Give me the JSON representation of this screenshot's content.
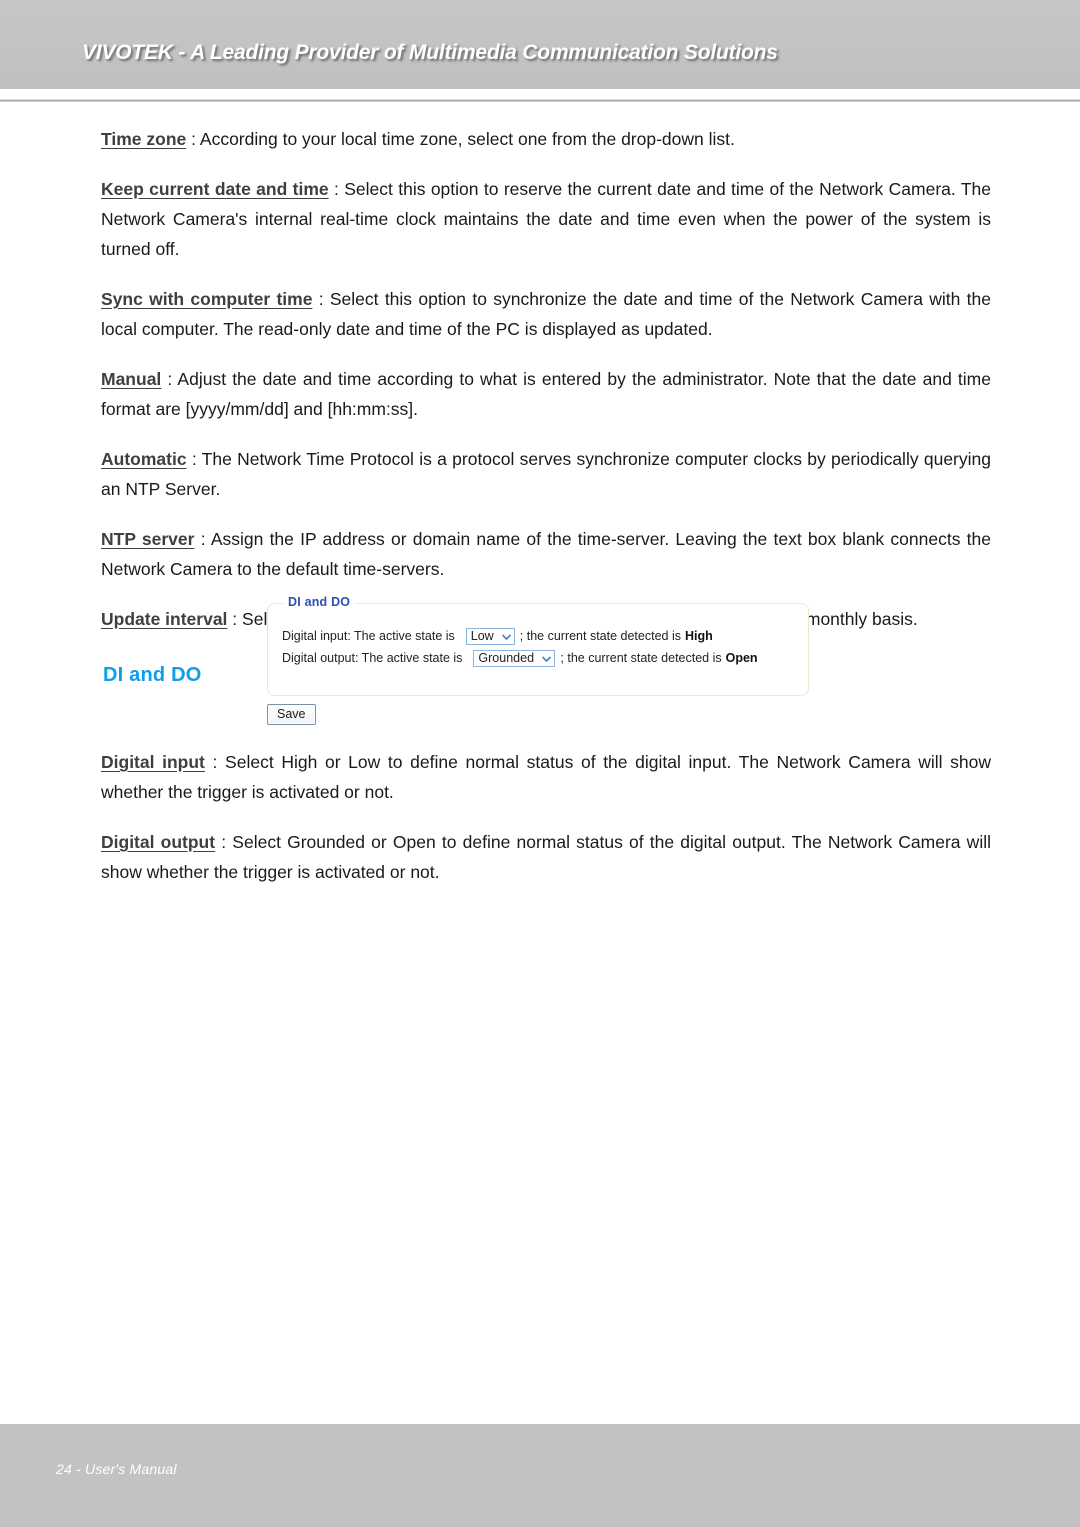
{
  "header": {
    "title": "VIVOTEK - A Leading Provider of Multimedia Communication Solutions"
  },
  "colors": {
    "header_band": "#c3c3c3",
    "heading_blue": "#0d9ee8",
    "legend_blue": "#2b4eb8",
    "panel_border": "#ece7d2",
    "select_border": "#8fb4df",
    "select_caret": "#3c7fd4",
    "footer_band": "#c2c2c2"
  },
  "paragraphs_upper": [
    {
      "term": "Time zone",
      "colon": " :",
      "body": " According to your local time zone, select one from the drop-down list."
    },
    {
      "term": "Keep current date and time",
      "colon": " :",
      "body": " Select this option to reserve the current date and time of the Network Camera. The Network Camera's internal real-time clock maintains the date and time even when the power of the system is turned off."
    },
    {
      "term": "Sync with computer time",
      "colon": " :",
      "body": " Select this option to synchronize the date and time of the Network Camera with the local computer. The read-only date and time of the PC is displayed as updated."
    },
    {
      "term": "Manual",
      "colon": " :",
      "body": " Adjust the date and time according to what is entered by the administrator. Note that the date and time format are [yyyy/mm/dd] and [hh:mm:ss]."
    },
    {
      "term": "Automatic",
      "colon": " :",
      "body": " The Network Time Protocol is a protocol serves synchronize computer clocks by periodically querying an NTP Server."
    },
    {
      "term": "NTP server",
      "colon": " :",
      "body": " Assign the IP address or domain name of the time-server. Leaving the text box blank connects the Network Camera to the default time-servers."
    },
    {
      "term": "Update interval",
      "colon": " :",
      "body": " Select to update the time with the NTP server on hourly, daily, weekly, or monthly basis."
    }
  ],
  "section": {
    "heading": "DI and DO"
  },
  "figure": {
    "legend": "DI and DO",
    "digital_input": {
      "label": "Digital input: The active state is",
      "select_value": "Low",
      "caret_icon": "chevron-down-icon",
      "detected_prefix": "; the current state detected is",
      "detected_value": "High"
    },
    "digital_output": {
      "label": "Digital output: The active state is",
      "select_value": "Grounded",
      "caret_icon": "chevron-down-icon",
      "detected_prefix": "; the current state detected is",
      "detected_value": "Open"
    },
    "save_label": "Save"
  },
  "paragraphs_lower": [
    {
      "term": "Digital input",
      "colon": " :",
      "body": " Select High or Low to define normal status of the digital input. The Network Camera will show whether the trigger is activated or not."
    },
    {
      "term": "Digital output",
      "colon": " :",
      "body": " Select Grounded or Open to define normal status of the digital output. The Network Camera will show whether the trigger is activated or not."
    }
  ],
  "footer": {
    "text": "24 - User's Manual"
  }
}
